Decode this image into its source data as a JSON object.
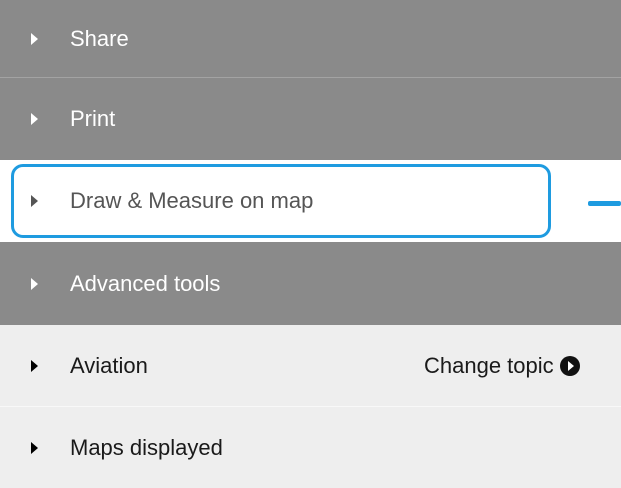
{
  "menu": {
    "share": {
      "label": "Share"
    },
    "print": {
      "label": "Print"
    },
    "draw_measure": {
      "label": "Draw & Measure on map"
    },
    "advanced_tools": {
      "label": "Advanced tools"
    },
    "aviation": {
      "label": "Aviation",
      "change_topic_label": "Change topic"
    },
    "maps_displayed": {
      "label": "Maps displayed"
    }
  },
  "colors": {
    "highlight": "#1e9be0",
    "dark_row": "#8a8a8a",
    "light_row": "#eeeeee"
  },
  "icons": {
    "expand": "caret-right-icon",
    "change_topic": "circle-chevron-right-icon"
  }
}
